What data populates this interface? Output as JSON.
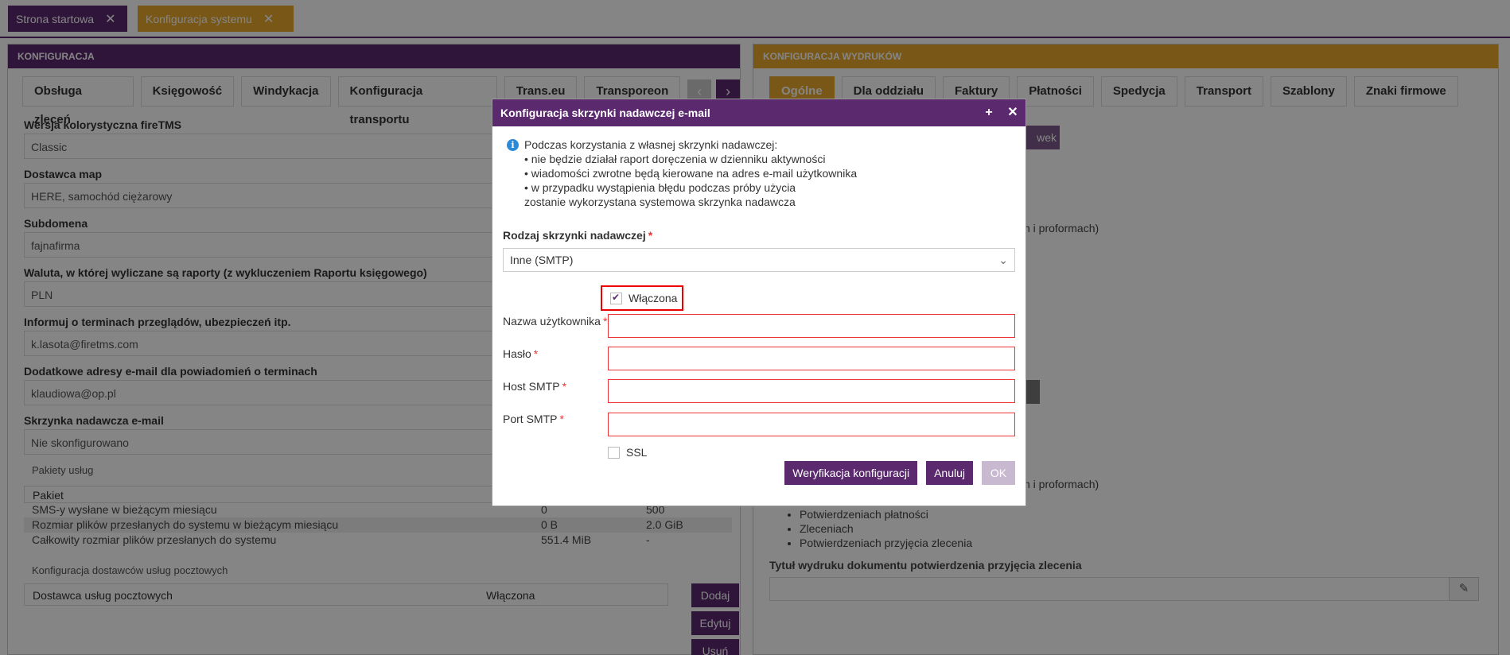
{
  "top_tabs": [
    {
      "label": "Strona startowa"
    },
    {
      "label": "Konfiguracja systemu"
    }
  ],
  "left_panel": {
    "title": "KONFIGURACJA",
    "tabs": [
      "Obsługa zleceń",
      "Księgowość",
      "Windykacja",
      "Konfiguracja transportu",
      "Trans.eu",
      "Transporeon"
    ],
    "fields": [
      {
        "label": "Wersja kolorystyczna fireTMS",
        "value": "Classic"
      },
      {
        "label": "Dostawca map",
        "value": "HERE, samochód ciężarowy"
      },
      {
        "label": "Subdomena",
        "value": "fajnafirma"
      },
      {
        "label": "Waluta, w której wyliczane są raporty (z wykluczeniem Raportu księgowego)",
        "value": "PLN"
      },
      {
        "label": "Informuj o terminach przeglądów, ubezpieczeń itp.",
        "value": "k.lasota@firetms.com"
      },
      {
        "label": "Dodatkowe adresy e-mail dla powiadomień o terminach",
        "value": "klaudiowa@op.pl"
      },
      {
        "label": "Skrzynka nadawcza e-mail",
        "value": "Nie skonfigurowano"
      }
    ],
    "packages": {
      "title": "Pakiety usług",
      "header": "Pakiet",
      "rows": [
        {
          "name": "SMS-y wysłane w bieżącym miesiącu",
          "used": "0",
          "limit": "500"
        },
        {
          "name": "Rozmiar plików przesłanych do systemu w bieżącym miesiącu",
          "used": "0 B",
          "limit": "2.0 GiB"
        },
        {
          "name": "Całkowity rozmiar plików przesłanych do systemu",
          "used": "551.4 MiB",
          "limit": "-"
        }
      ]
    },
    "postal": {
      "title": "Konfiguracja dostawców usług pocztowych",
      "col1": "Dostawca usług pocztowych",
      "col2": "Włączona",
      "add": "Dodaj",
      "edit": "Edytuj",
      "remove": "Usuń"
    }
  },
  "right_panel": {
    "title": "KONFIGURACJA WYDRUKÓW",
    "tabs": [
      "Ogólne",
      "Dla oddziału",
      "Faktury",
      "Płatności",
      "Spedycja",
      "Transport",
      "Szablony",
      "Znaki firmowe"
    ],
    "partial_button": "wek",
    "partial_text_1": "h i proformach)",
    "partial_text_2": "h i proformach)",
    "list": [
      "Potwierdzeniach płatności",
      "Zleceniach",
      "Potwierdzeniach przyjęcia zlecenia"
    ],
    "print_title_label": "Tytuł wydruku dokumentu potwierdzenia przyjęcia zlecenia"
  },
  "modal": {
    "title": "Konfiguracja skrzynki nadawczej e-mail",
    "info_lines": [
      "Podczas korzystania z własnej skrzynki nadawczej:",
      "• nie będzie działał raport doręczenia w dzienniku aktywności",
      "• wiadomości zwrotne będą kierowane na adres e-mail użytkownika",
      "• w przypadku wystąpienia błędu podczas próby użycia",
      "zostanie wykorzystana systemowa skrzynka nadawcza"
    ],
    "type_label": "Rodzaj skrzynki nadawczej",
    "type_value": "Inne (SMTP)",
    "enabled_label": "Włączona",
    "username_label": "Nazwa użytkownika",
    "password_label": "Hasło",
    "host_label": "Host SMTP",
    "port_label": "Port SMTP",
    "ssl_label": "SSL",
    "verify_button": "Weryfikacja konfiguracji",
    "cancel_button": "Anuluj",
    "ok_button": "OK"
  }
}
